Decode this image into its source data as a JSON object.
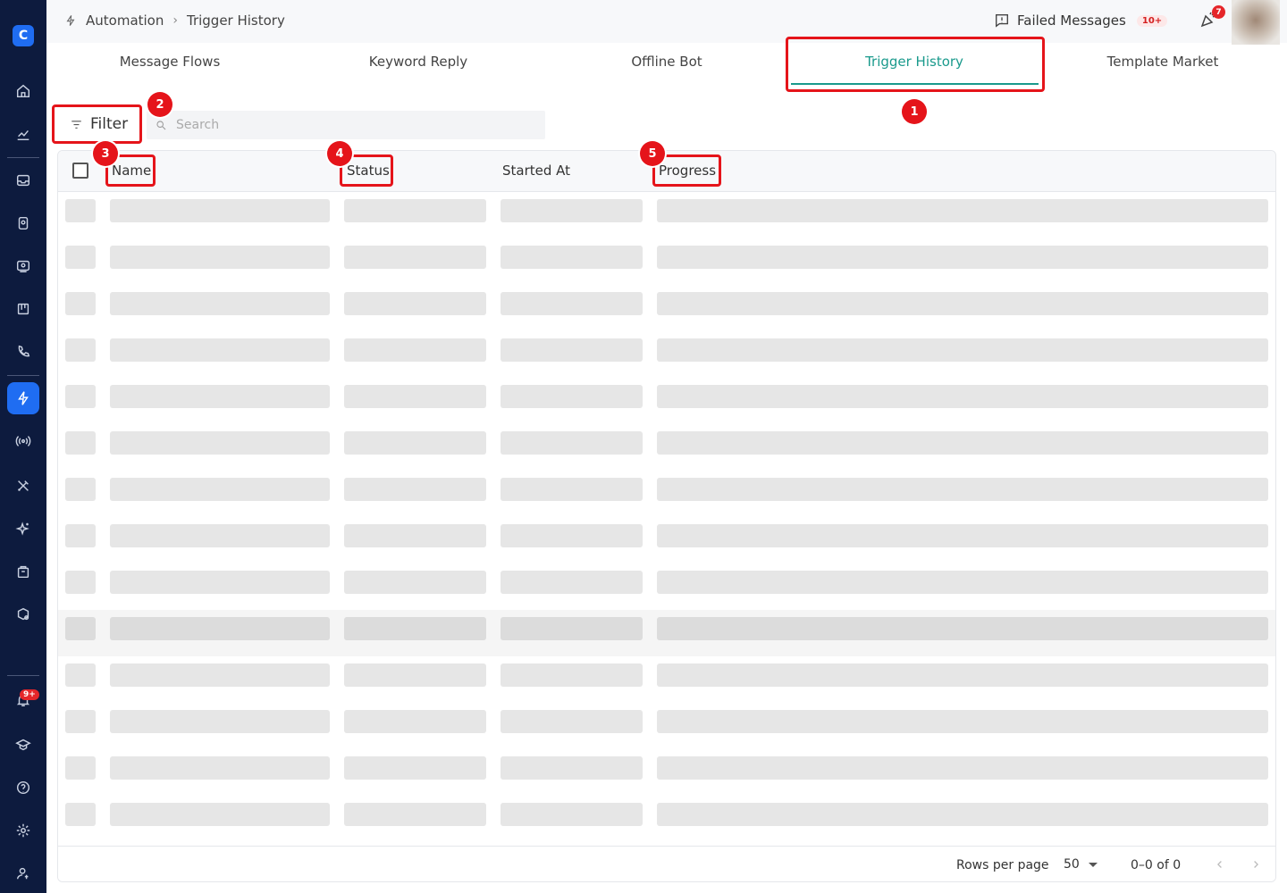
{
  "header": {
    "breadcrumb": [
      "Automation",
      "Trigger History"
    ],
    "failed_messages_label": "Failed Messages",
    "failed_messages_count": "10+",
    "notification_count": "7"
  },
  "sidebar": {
    "logo_letter": "C",
    "notifications_badge": "9+",
    "items": [
      "home-icon",
      "analytics-icon",
      "inbox-icon",
      "contacts-icon",
      "chat-icon",
      "board-icon",
      "phone-icon",
      "automation-icon",
      "broadcast-icon",
      "tools-icon",
      "ai-icon",
      "commerce-icon",
      "integrations-icon",
      "notifications-icon",
      "learning-icon",
      "help-icon",
      "settings-icon",
      "account-icon"
    ],
    "active_item": "automation-icon"
  },
  "tabs": [
    {
      "label": "Message Flows",
      "active": false
    },
    {
      "label": "Keyword Reply",
      "active": false
    },
    {
      "label": "Offline Bot",
      "active": false
    },
    {
      "label": "Trigger History",
      "active": true
    },
    {
      "label": "Template Market",
      "active": false
    }
  ],
  "toolbar": {
    "filter_label": "Filter",
    "search_placeholder": "Search"
  },
  "table": {
    "columns": [
      "Name",
      "Status",
      "Started At",
      "Progress"
    ],
    "loading_rows": 14,
    "highlighted_row": 10
  },
  "pagination": {
    "rows_per_page_label": "Rows per page",
    "rows_per_page_value": "50",
    "range": "0–0 of 0"
  },
  "annotations": [
    "1",
    "2",
    "3",
    "4",
    "5"
  ],
  "colors": {
    "sidebar_bg": "#0d1b3e",
    "accent_teal": "#1a9a8c",
    "brand_blue": "#1f6df2",
    "annotation_red": "#e5141a"
  }
}
